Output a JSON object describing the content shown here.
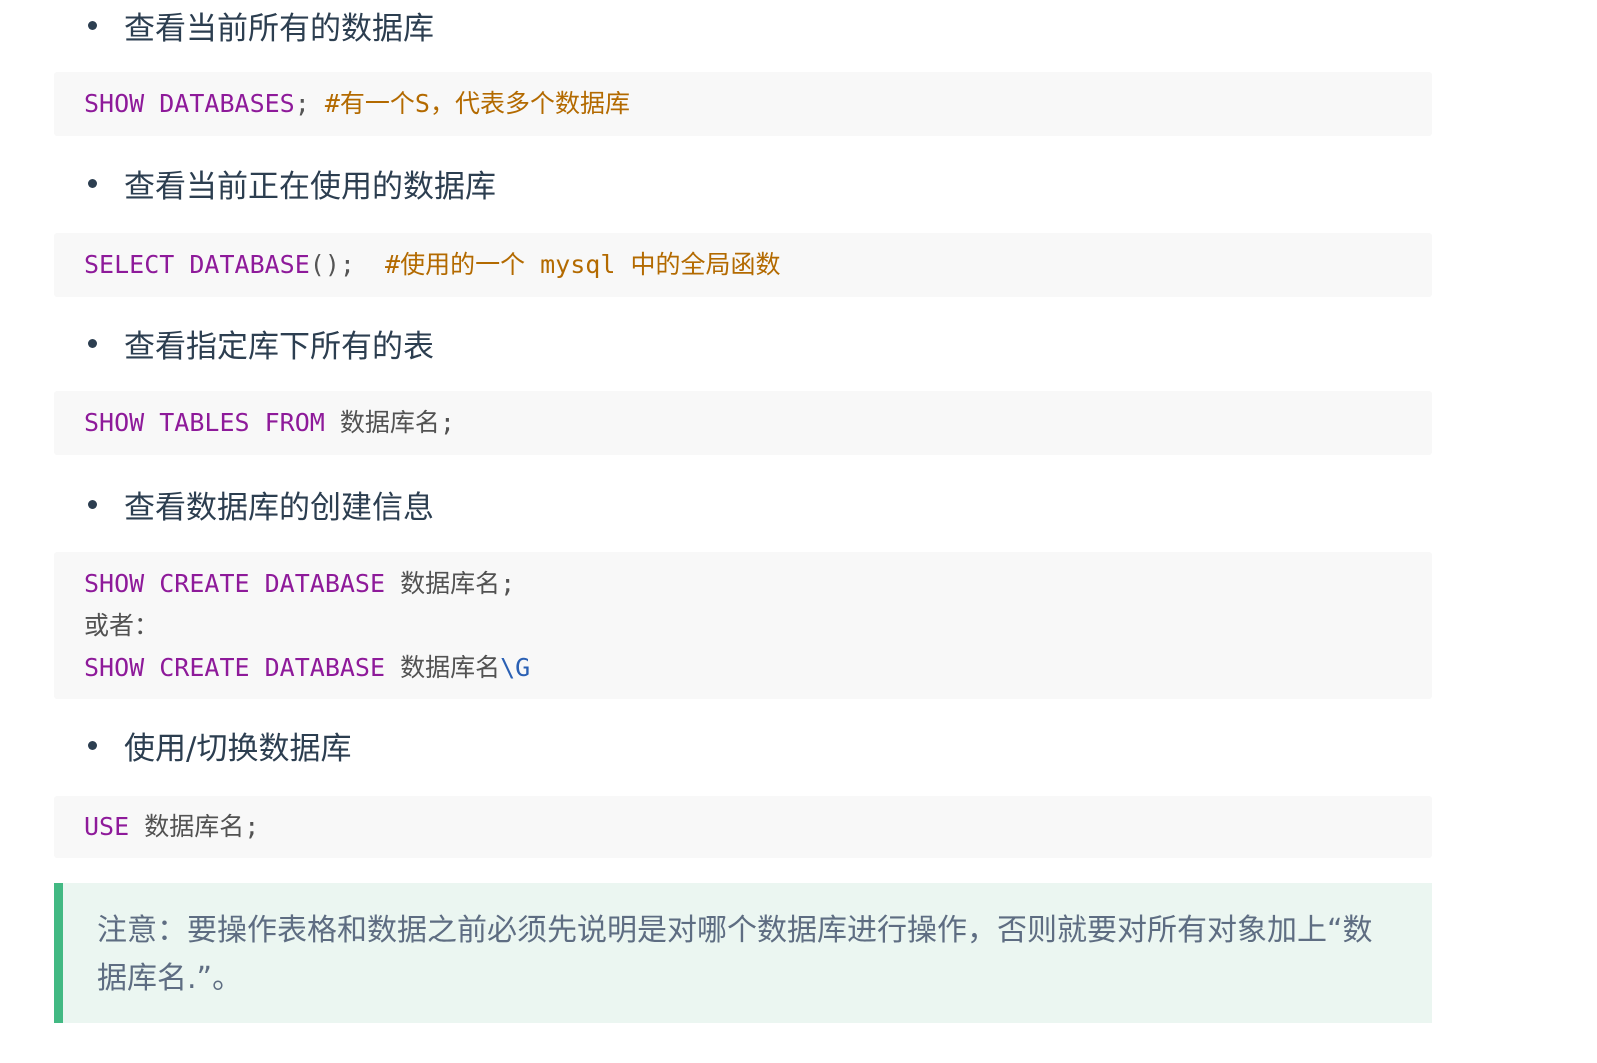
{
  "sections": [
    {
      "heading": "查看当前所有的数据库",
      "code": [
        [
          {
            "t": "SHOW DATABASES",
            "c": "kw"
          },
          {
            "t": ";",
            "c": "pu"
          },
          {
            "t": " ",
            "c": "tx"
          },
          {
            "t": "#有一个S，代表多个数据库",
            "c": "cm"
          }
        ]
      ]
    },
    {
      "heading": "查看当前正在使用的数据库",
      "code": [
        [
          {
            "t": "SELECT DATABASE",
            "c": "kw"
          },
          {
            "t": "();  ",
            "c": "pu"
          },
          {
            "t": "#使用的一个 mysql 中的全局函数",
            "c": "cm"
          }
        ]
      ]
    },
    {
      "heading": "查看指定库下所有的表",
      "code": [
        [
          {
            "t": "SHOW TABLES FROM",
            "c": "kw"
          },
          {
            "t": " 数据库名;",
            "c": "tx"
          }
        ]
      ]
    },
    {
      "heading": "查看数据库的创建信息",
      "code": [
        [
          {
            "t": "SHOW CREATE DATABASE",
            "c": "kw"
          },
          {
            "t": " 数据库名;",
            "c": "tx"
          }
        ],
        [
          {
            "t": "或者：",
            "c": "tx"
          }
        ],
        [
          {
            "t": "SHOW CREATE DATABASE",
            "c": "kw"
          },
          {
            "t": " 数据库名",
            "c": "tx"
          },
          {
            "t": "\\G",
            "c": "esc"
          }
        ]
      ]
    },
    {
      "heading": "使用/切换数据库",
      "code": [
        [
          {
            "t": "USE",
            "c": "kw"
          },
          {
            "t": " 数据库名;",
            "c": "tx"
          }
        ]
      ]
    }
  ],
  "tip": {
    "text": "注意：要操作表格和数据之前必须先说明是对哪个数据库进行操作，否则就要对所有对象加上“数据库名.”。"
  },
  "colors": {
    "keyword": "#8e1a9a",
    "comment": "#b36a00",
    "escape": "#2a60b4",
    "tip_border": "#42b983",
    "tip_background": "#ebf6f1",
    "code_background": "#f8f8f8"
  }
}
